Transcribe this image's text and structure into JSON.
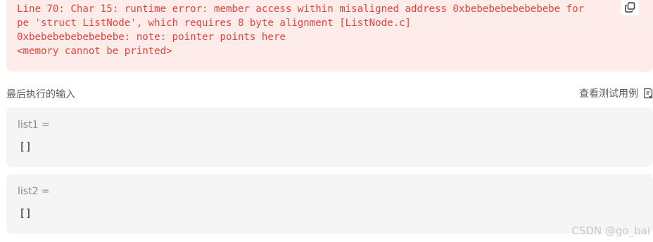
{
  "error": {
    "lines": [
      "Line 70: Char 15: runtime error: member access within misaligned address 0xbebebebebebebebe for",
      "pe 'struct ListNode', which requires 8 byte alignment [ListNode.c]",
      "0xbebebebebebebebe: note: pointer points here",
      "<memory cannot be printed>"
    ],
    "copy_icon": "copy-icon",
    "text_color": "#e2463b",
    "background_color": "#fdecea"
  },
  "last_input": {
    "title": "最后执行的输入",
    "view_cases_label": "查看测试用例",
    "view_cases_icon": "test-case-document-icon"
  },
  "inputs": [
    {
      "label": "list1 =",
      "value": "[]"
    },
    {
      "label": "list2 =",
      "value": "[]"
    }
  ],
  "watermark": "CSDN @go_bai"
}
